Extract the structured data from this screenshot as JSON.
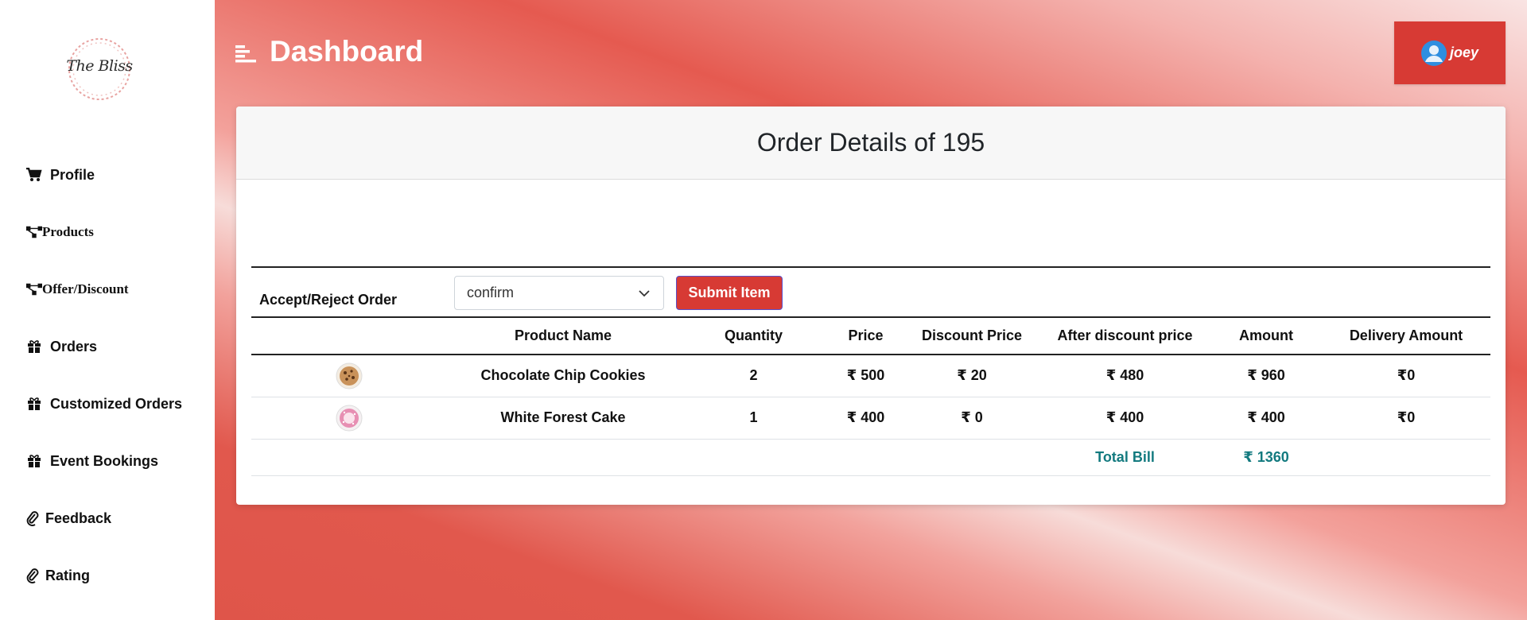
{
  "app": {
    "logo_text": "The Bliss",
    "title": "Dashboard",
    "user": "joey"
  },
  "sidebar": {
    "items": [
      {
        "label": "Profile",
        "icon": "cart-icon"
      },
      {
        "label": "Products",
        "icon": "sitemap-icon"
      },
      {
        "label": "Offer/Discount",
        "icon": "sitemap-icon"
      },
      {
        "label": "Orders",
        "icon": "gift-icon"
      },
      {
        "label": "Customized Orders",
        "icon": "gift-icon"
      },
      {
        "label": "Event Bookings",
        "icon": "gift-icon"
      },
      {
        "label": "Feedback",
        "icon": "paperclip-icon"
      },
      {
        "label": "Rating",
        "icon": "paperclip-icon"
      }
    ]
  },
  "order": {
    "title": "Order Details of 195",
    "accept_label": "Accept/Reject Order",
    "status_value": "confirm",
    "submit_label": "Submit Item",
    "columns": [
      "",
      "Product Name",
      "Quantity",
      "Price",
      "Discount Price",
      "After discount price",
      "Amount",
      "Delivery Amount"
    ],
    "rows": [
      {
        "image": "cookies-image",
        "name": "Chocolate Chip Cookies",
        "quantity": "2",
        "price": "₹ 500",
        "discount": "₹ 20",
        "after_discount": "₹ 480",
        "amount": "₹ 960",
        "delivery": "₹0"
      },
      {
        "image": "cake-image",
        "name": "White Forest Cake",
        "quantity": "1",
        "price": "₹ 400",
        "discount": "₹ 0",
        "after_discount": "₹ 400",
        "amount": "₹ 400",
        "delivery": "₹0"
      }
    ],
    "total_label": "Total Bill",
    "total_value": "₹ 1360"
  },
  "colors": {
    "accent": "#d73a34",
    "total_text": "#137a7f"
  }
}
